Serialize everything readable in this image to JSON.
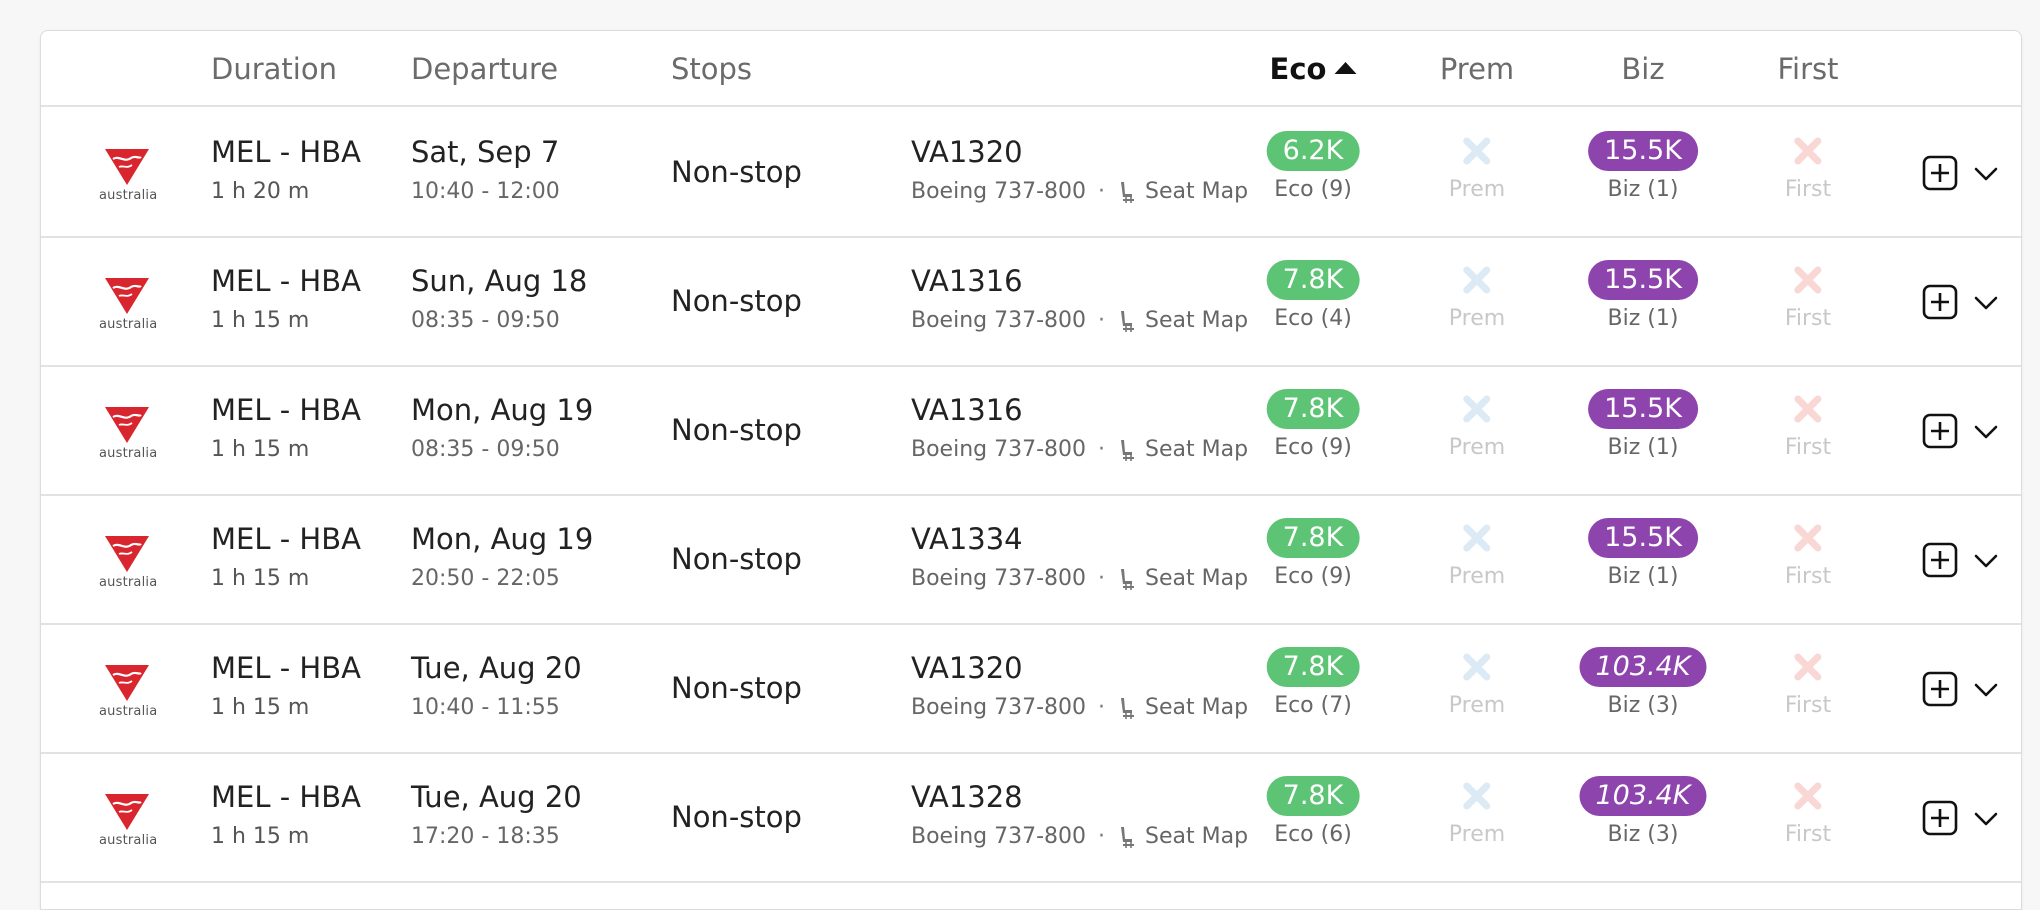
{
  "header": {
    "duration": "Duration",
    "departure": "Departure",
    "stops": "Stops",
    "eco": "Eco",
    "prem": "Prem",
    "biz": "Biz",
    "first": "First"
  },
  "logo_text": "australia",
  "colors": {
    "eco_pill": "#5cc474",
    "biz_pill": "#8e44ad",
    "prem_unavailable": "#dbeaf5",
    "first_unavailable": "#f8d7d5",
    "virgin_red": "#d9262e"
  },
  "rows": [
    {
      "route": "MEL - HBA",
      "duration": "1 h 20 m",
      "date": "Sat, Sep 7",
      "times": "10:40 - 12:00",
      "stops": "Non-stop",
      "flight": "VA1320",
      "aircraft": "Boeing 737-800",
      "dot": "·",
      "seatmap": "Seat Map",
      "eco_price": "6.2K",
      "eco_label": "Eco (9)",
      "prem_label": "Prem",
      "biz_price": "15.5K",
      "biz_label": "Biz (1)",
      "first_label": "First",
      "biz_italic": false
    },
    {
      "route": "MEL - HBA",
      "duration": "1 h 15 m",
      "date": "Sun, Aug 18",
      "times": "08:35 - 09:50",
      "stops": "Non-stop",
      "flight": "VA1316",
      "aircraft": "Boeing 737-800",
      "dot": "·",
      "seatmap": "Seat Map",
      "eco_price": "7.8K",
      "eco_label": "Eco (4)",
      "prem_label": "Prem",
      "biz_price": "15.5K",
      "biz_label": "Biz (1)",
      "first_label": "First",
      "biz_italic": false
    },
    {
      "route": "MEL - HBA",
      "duration": "1 h 15 m",
      "date": "Mon, Aug 19",
      "times": "08:35 - 09:50",
      "stops": "Non-stop",
      "flight": "VA1316",
      "aircraft": "Boeing 737-800",
      "dot": "·",
      "seatmap": "Seat Map",
      "eco_price": "7.8K",
      "eco_label": "Eco (9)",
      "prem_label": "Prem",
      "biz_price": "15.5K",
      "biz_label": "Biz (1)",
      "first_label": "First",
      "biz_italic": false
    },
    {
      "route": "MEL - HBA",
      "duration": "1 h 15 m",
      "date": "Mon, Aug 19",
      "times": "20:50 - 22:05",
      "stops": "Non-stop",
      "flight": "VA1334",
      "aircraft": "Boeing 737-800",
      "dot": "·",
      "seatmap": "Seat Map",
      "eco_price": "7.8K",
      "eco_label": "Eco (9)",
      "prem_label": "Prem",
      "biz_price": "15.5K",
      "biz_label": "Biz (1)",
      "first_label": "First",
      "biz_italic": false
    },
    {
      "route": "MEL - HBA",
      "duration": "1 h 15 m",
      "date": "Tue, Aug 20",
      "times": "10:40 - 11:55",
      "stops": "Non-stop",
      "flight": "VA1320",
      "aircraft": "Boeing 737-800",
      "dot": "·",
      "seatmap": "Seat Map",
      "eco_price": "7.8K",
      "eco_label": "Eco (7)",
      "prem_label": "Prem",
      "biz_price": "103.4K",
      "biz_label": "Biz (3)",
      "first_label": "First",
      "biz_italic": true
    },
    {
      "route": "MEL - HBA",
      "duration": "1 h 15 m",
      "date": "Tue, Aug 20",
      "times": "17:20 - 18:35",
      "stops": "Non-stop",
      "flight": "VA1328",
      "aircraft": "Boeing 737-800",
      "dot": "·",
      "seatmap": "Seat Map",
      "eco_price": "7.8K",
      "eco_label": "Eco (6)",
      "prem_label": "Prem",
      "biz_price": "103.4K",
      "biz_label": "Biz (3)",
      "first_label": "First",
      "biz_italic": true
    }
  ]
}
